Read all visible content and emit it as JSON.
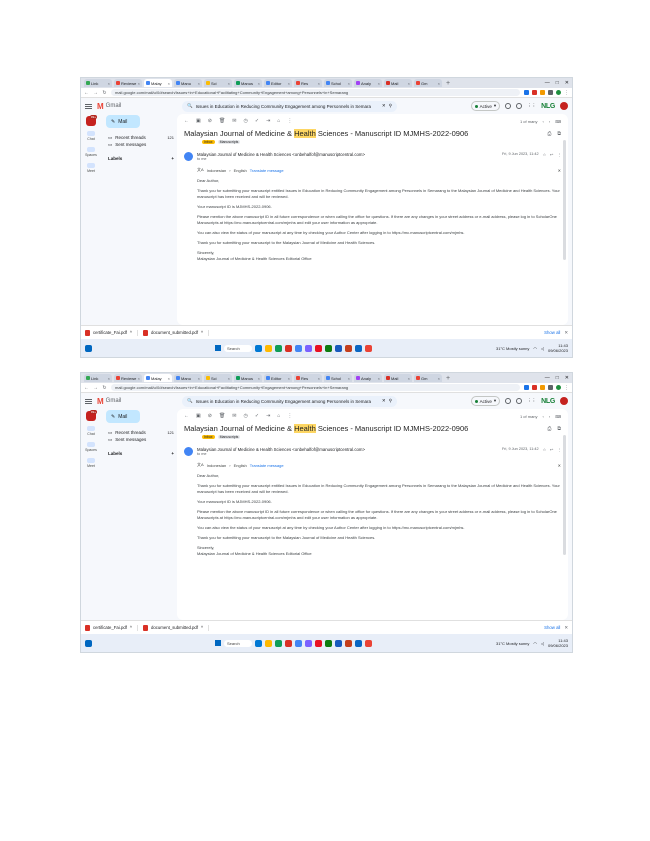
{
  "tabs": [
    {
      "label": "Link",
      "color": "#34a853"
    },
    {
      "label": "Reviewe",
      "color": "#ea4335"
    },
    {
      "label": "Malay",
      "color": "#4285f4"
    },
    {
      "label": "Manu",
      "color": "#4285f4"
    },
    {
      "label": "Sci",
      "color": "#fbbc04"
    },
    {
      "label": "Manus",
      "color": "#0f9d58"
    },
    {
      "label": "Editor",
      "color": "#4285f4"
    },
    {
      "label": "Res",
      "color": "#ea4335"
    },
    {
      "label": "Schol",
      "color": "#4285f4"
    },
    {
      "label": "Analy",
      "color": "#a142f4"
    },
    {
      "label": "Mail",
      "color": "#d93025"
    },
    {
      "label": "Gm",
      "color": "#ea4335"
    }
  ],
  "browser": {
    "url": "mail.google.com/mail/u/0/#search/Issues+in+Educational+Facilitating+Community+Engagement+among+Personnels+in+Semarang",
    "window_controls": [
      "—",
      "□",
      "✕"
    ],
    "new_tab": "+"
  },
  "gmail": {
    "product_name": "Gmail",
    "search_query": "Issues in Education in Reducing Community Engagement among Personnels in Semara",
    "status_label": "Active",
    "brand": "NLG",
    "compose_label": "Mail",
    "rail": [
      {
        "label": "Mail",
        "icon": "mail-icon"
      },
      {
        "label": "Chat",
        "icon": "chat-icon"
      },
      {
        "label": "Spaces",
        "icon": "spaces-icon"
      },
      {
        "label": "Meet",
        "icon": "meet-icon"
      }
    ],
    "folders": [
      {
        "label": "Recent threads",
        "count": "121"
      },
      {
        "label": "Sent messages",
        "count": ""
      }
    ],
    "labels_heading": "Labels",
    "pager": "1 of many"
  },
  "email": {
    "subject_pre": "Malaysian Journal of Medicine & ",
    "subject_hl": "Health",
    "subject_post": " Sciences - Manuscript ID MJMHS-2022-0906",
    "chips": [
      "Inbox",
      "Manuscripts"
    ],
    "sender": "Malaysian Journal of Medicine & Health Sciences <onbehalfof@manuscriptcentral.com>",
    "to": "to me",
    "date": "Fri, 9 Jun 2023, 11:42",
    "translate_from": "Indonesian",
    "translate_to": "English",
    "translate_link": "Translate message",
    "body": [
      "Dear Author,",
      "Thank you for submitting your manuscript entitled Issues in Education in Reducing Community Engagement among Personnels in Semarang to the Malaysian Journal of Medicine and Health Sciences. Your manuscript has been received and will be reviewed.",
      "Your manuscript ID is MJMHS-2022-0906.",
      "Please mention the above manuscript ID in all future correspondence or when calling the office for questions. If there are any changes in your street address or e-mail address, please log in to ScholarOne Manuscripts at https://mc.manuscriptcentral.com/mjmhs and edit your user information as appropriate.",
      "You can also view the status of your manuscript at any time by checking your Author Center after logging in to https://mc.manuscriptcentral.com/mjmhs.",
      "Thank you for submitting your manuscript to the Malaysian Journal of Medicine and Health Sciences.",
      "Sincerely,",
      "Malaysian Journal of Medicine & Health Sciences Editorial Office"
    ]
  },
  "downloads": [
    {
      "label": "certificate_Fai.pdf"
    },
    {
      "label": "document_submitted.pdf"
    }
  ],
  "downloads_show_all": "Show all",
  "taskbar": {
    "search": "Search",
    "weather": "31°C Mostly sunny",
    "time": "11:43",
    "date": "09/06/2023",
    "icons": [
      "#0078d4",
      "#ffb900",
      "#0f9d58",
      "#d93025",
      "#4285f4",
      "#7b61ff",
      "#e81123",
      "#107c10",
      "#185abd",
      "#c43e1c",
      "#0a66c2",
      "#ea4335"
    ]
  }
}
